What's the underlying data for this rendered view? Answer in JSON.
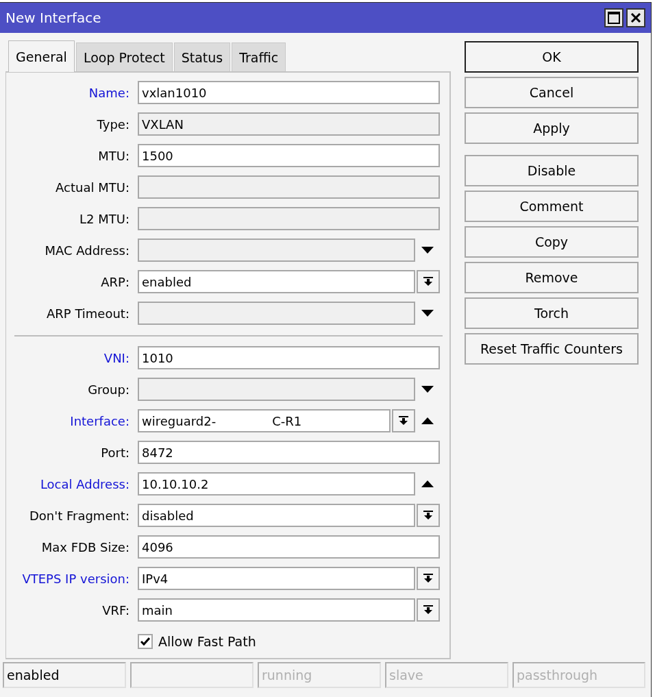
{
  "window": {
    "title": "New Interface"
  },
  "tabs": [
    {
      "label": "General",
      "selected": true
    },
    {
      "label": "Loop Protect",
      "selected": false
    },
    {
      "label": "Status",
      "selected": false
    },
    {
      "label": "Traffic",
      "selected": false
    }
  ],
  "fields": [
    {
      "label": "Name:",
      "highlighted": true,
      "editable": true,
      "value": "vxlan1010"
    },
    {
      "label": "Type:",
      "highlighted": false,
      "editable": false,
      "value": "VXLAN"
    },
    {
      "label": "MTU:",
      "highlighted": false,
      "editable": true,
      "value": "1500"
    },
    {
      "label": "Actual MTU:",
      "highlighted": false,
      "editable": false
    },
    {
      "label": "L2 MTU:",
      "highlighted": false,
      "editable": false
    },
    {
      "label": "MAC Address:",
      "highlighted": false,
      "editable": false,
      "dropdown_arrow": true
    },
    {
      "label": "ARP:",
      "highlighted": false,
      "editable": true,
      "value": "enabled",
      "combo": true
    },
    {
      "label": "ARP Timeout:",
      "highlighted": false,
      "editable": false,
      "dropdown_arrow": true,
      "separator_after": true
    },
    {
      "label": "VNI:",
      "highlighted": true,
      "editable": true,
      "value": "1010"
    },
    {
      "label": "Group:",
      "highlighted": false,
      "editable": false,
      "dropdown_arrow": true
    },
    {
      "label": "Interface:",
      "highlighted": true,
      "editable": true,
      "value": "wireguard2-",
      "value_end": "C-R1",
      "combo": true,
      "collapse_arrow": true
    },
    {
      "label": "Port:",
      "highlighted": false,
      "editable": true,
      "value": "8472"
    },
    {
      "label": "Local Address:",
      "highlighted": true,
      "editable": true,
      "value": "10.10.10.2",
      "collapse_arrow": true
    },
    {
      "label": "Don't Fragment:",
      "highlighted": false,
      "editable": true,
      "value": "disabled",
      "combo": true
    },
    {
      "label": "Max FDB Size:",
      "highlighted": false,
      "editable": true,
      "value": "4096"
    },
    {
      "label": "VTEPS IP version:",
      "highlighted": true,
      "editable": true,
      "value": "IPv4",
      "combo": true
    },
    {
      "label": "VRF:",
      "highlighted": false,
      "editable": true,
      "value": "main",
      "combo": true
    }
  ],
  "checkbox": {
    "label": "Allow Fast Path",
    "checked": true
  },
  "button_groups": [
    [
      {
        "label": "OK",
        "default": true
      },
      {
        "label": "Cancel",
        "default": false
      },
      {
        "label": "Apply",
        "default": false
      }
    ],
    [
      {
        "label": "Disable"
      },
      {
        "label": "Comment"
      },
      {
        "label": "Copy"
      },
      {
        "label": "Remove"
      },
      {
        "label": "Torch"
      },
      {
        "label": "Reset Traffic Counters"
      }
    ]
  ],
  "status_bar": [
    {
      "kind": "text",
      "text": "enabled",
      "active": true
    },
    {
      "kind": "empty"
    },
    {
      "kind": "text",
      "text": "running",
      "active": false
    },
    {
      "kind": "text",
      "text": "slave",
      "active": false
    },
    {
      "kind": "text",
      "text": "passthrough",
      "active": false
    }
  ]
}
